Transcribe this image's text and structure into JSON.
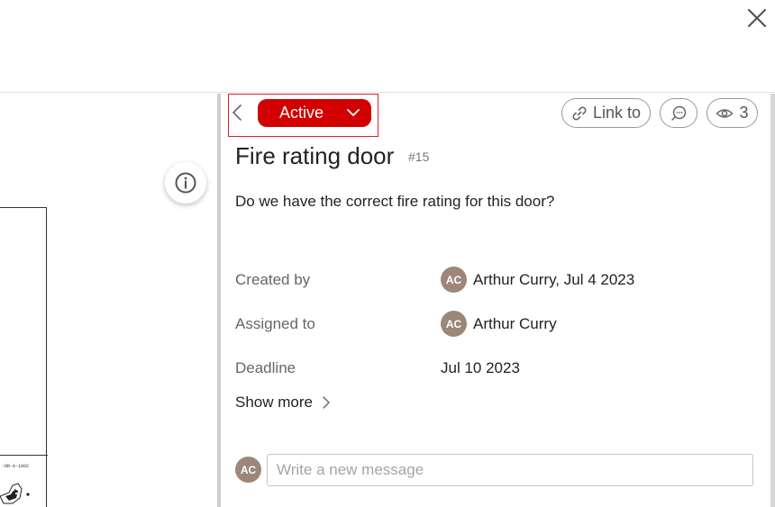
{
  "header": {
    "close_icon": "close-icon"
  },
  "viewer": {
    "drawing_code": "-DR-A-1002",
    "info_icon": "info-icon"
  },
  "issue": {
    "status": "Active",
    "status_color": "#d30000",
    "link_label": "Link to",
    "watchers_count": "3",
    "title": "Fire rating door",
    "number": "#15",
    "description": "Do we have the correct fire rating for this door?"
  },
  "fields": {
    "created_by_label": "Created by",
    "created_by_initials": "AC",
    "created_by_value": "Arthur Curry, Jul 4 2023",
    "assigned_to_label": "Assigned to",
    "assigned_to_initials": "AC",
    "assigned_to_value": "Arthur Curry",
    "deadline_label": "Deadline",
    "deadline_value": "Jul 10 2023",
    "show_more_label": "Show more"
  },
  "composer": {
    "avatar_initials": "AC",
    "placeholder": "Write a new message"
  }
}
